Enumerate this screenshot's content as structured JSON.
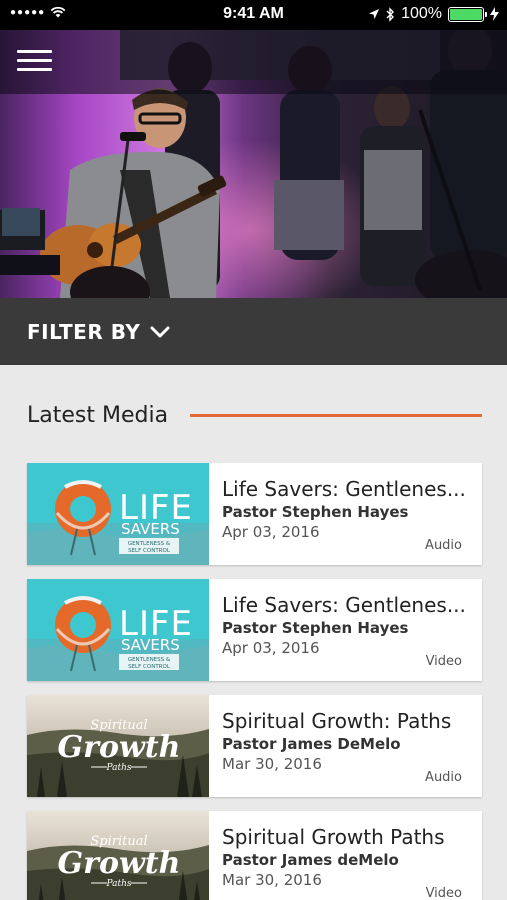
{
  "status_bar": {
    "signal": "●●●●●",
    "time": "9:41 AM",
    "battery": "100%"
  },
  "icons": {
    "menu": "hamburger-icon",
    "filter": "chevron-down-icon",
    "wifi": "wifi-icon",
    "location": "location-arrow-icon",
    "bluetooth": "bluetooth-icon",
    "battery": "battery-icon",
    "charging": "charging-bolt-icon"
  },
  "filter": {
    "label": "FILTER BY"
  },
  "section": {
    "title": "Latest Media"
  },
  "colors": {
    "accent": "#e46a35",
    "filter_bg": "#3a3a3a",
    "battery": "#4cd964"
  },
  "thumbnails": {
    "life_savers": {
      "word1": "LIFE",
      "word2": "SAVERS",
      "sub1": "GENTLENESS &",
      "sub2": "SELF CONTROL"
    },
    "spiritual_growth": {
      "word1": "Spiritual",
      "word2": "Growth",
      "sub": "Paths"
    }
  },
  "media": [
    {
      "title": "Life Savers: Gentlenes...",
      "speaker": "Pastor Stephen Hayes",
      "date": "Apr 03, 2016",
      "type": "Audio",
      "thumb": "life_savers"
    },
    {
      "title": "Life Savers: Gentlenes...",
      "speaker": "Pastor Stephen Hayes",
      "date": "Apr 03, 2016",
      "type": "Video",
      "thumb": "life_savers"
    },
    {
      "title": "Spiritual Growth: Paths",
      "speaker": "Pastor James DeMelo",
      "date": "Mar 30, 2016",
      "type": "Audio",
      "thumb": "spiritual_growth"
    },
    {
      "title": "Spiritual Growth Paths",
      "speaker": "Pastor James deMelo",
      "date": "Mar 30, 2016",
      "type": "Video",
      "thumb": "spiritual_growth"
    }
  ]
}
